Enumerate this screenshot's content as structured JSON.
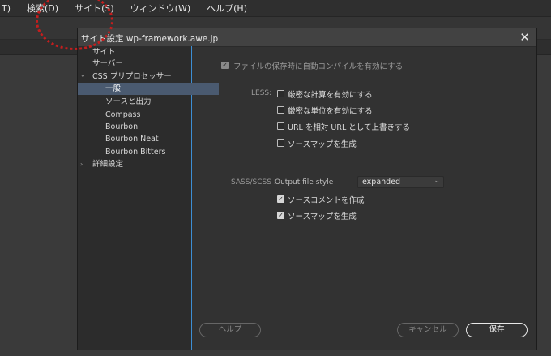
{
  "menu": {
    "items": [
      "T)",
      "検索(D)",
      "サイト(S)",
      "ウィンドウ(W)",
      "ヘルプ(H)"
    ]
  },
  "dialog": {
    "title": "サイト設定 wp-framework.awe.jp",
    "close": "✕"
  },
  "sidebar": {
    "items": [
      {
        "label": "サイト"
      },
      {
        "label": "サーバー"
      },
      {
        "label": "CSS プリプロセッサー"
      },
      {
        "label": "一般"
      },
      {
        "label": "ソースと出力"
      },
      {
        "label": "Compass"
      },
      {
        "label": "Bourbon"
      },
      {
        "label": "Bourbon Neat"
      },
      {
        "label": "Bourbon Bitters"
      },
      {
        "label": "詳細設定"
      }
    ],
    "chevron_expanded": "⌄",
    "chevron_collapsed": "›"
  },
  "general": {
    "auto_compile": {
      "label": "ファイルの保存時に自動コンパイルを有効にする",
      "checked": true
    },
    "less_label": "LESS:",
    "less_options": [
      {
        "label": "厳密な計算を有効にする",
        "checked": false
      },
      {
        "label": "厳密な単位を有効にする",
        "checked": false
      },
      {
        "label": "URL を相対 URL として上書きする",
        "checked": false
      },
      {
        "label": "ソースマップを生成",
        "checked": false
      }
    ],
    "sass_label": "SASS/SCSS :",
    "output_style_label": "Output file style",
    "output_style_value": "expanded",
    "select_arrow": "⌄",
    "check_mark": "✓",
    "sass_options": [
      {
        "label": "ソースコメントを作成",
        "checked": true
      },
      {
        "label": "ソースマップを生成",
        "checked": true
      }
    ]
  },
  "buttons": {
    "help": "ヘルプ",
    "cancel": "キャンセル",
    "save": "保存"
  }
}
